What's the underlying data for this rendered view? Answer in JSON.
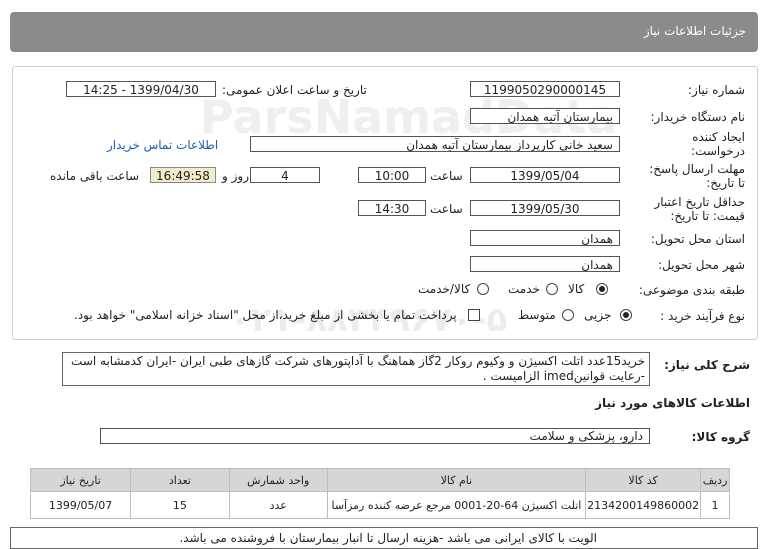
{
  "header": {
    "title": "جزئیات اطلاعات نیاز"
  },
  "form": {
    "need_number_label": "شماره نیاز:",
    "need_number": "1199050290000145",
    "announce_label": "تاریخ و ساعت اعلان عمومی:",
    "announce_value": "1399/04/30 - 14:25",
    "buyer_label": "نام دستگاه خریدار:",
    "buyer_value": "بیمارستان آتیه همدان",
    "creator_label_1": "ایجاد کننده",
    "creator_label_2": "درخواست:",
    "creator_value": "سعید خانی کارپرداز بیمارستان آتیه همدان",
    "contact_link": "اطلاعات تماس خریدار",
    "deadline_label_1": "مهلت ارسال پاسخ:",
    "deadline_label_2": "تا تاریخ:",
    "deadline_date": "1399/05/04",
    "time_label": "ساعت",
    "deadline_time": "10:00",
    "days_value": "4",
    "days_label": "روز و",
    "remaining_time": "16:49:58",
    "remaining_label": "ساعت باقی مانده",
    "validity_label_1": "حداقل تاریخ اعتبار",
    "validity_label_2": "قیمت: تا تاریخ:",
    "validity_date": "1399/05/30",
    "validity_time": "14:30",
    "province_label": "استان محل تحویل:",
    "province_value": "همدان",
    "city_label": "شهر محل تحویل:",
    "city_value": "همدان",
    "category_label": "طبقه بندی موضوعی:",
    "category_options": [
      "کالا",
      "خدمت",
      "کالا/خدمت"
    ],
    "category_selected": "کالا",
    "process_label": "نوع فرآیند خرید :",
    "process_options": [
      "جزیی",
      "متوسط"
    ],
    "process_selected": "جزیی",
    "payment_note": "پرداخت تمام یا بخشی از مبلغ خرید،از محل \"اسناد خزانه اسلامی\" خواهد بود."
  },
  "description": {
    "label": "شرح کلی نیاز:",
    "text": "خرید15عدد اتلت اکسیژن و وکیوم روکار 2گاز هماهنگ با آداپتورهای شرکت گازهای طبی ایران -ایران کدمشابه است -رعایت قوانینimed الزامیست ."
  },
  "goods": {
    "section_title": "اطلاعات کالاهای مورد نیاز",
    "group_label": "گروه کالا:",
    "group_value": "دارو، پزشکی و سلامت",
    "columns": [
      "ردیف",
      "کد کالا",
      "نام کالا",
      "واحد شمارش",
      "تعداد",
      "تاریخ نیاز"
    ],
    "rows": [
      {
        "index": "1",
        "code": "2134200149860002",
        "name": "اتلت اکسیژن 64-20-0001 مرجع عرضه کننده رمزآسا",
        "unit": "عدد",
        "qty": "15",
        "date": "1399/05/07"
      }
    ]
  },
  "note": "الویت با کالای ایرانی می باشد -هزینه ارسال تا انبار بیمارستان با فروشنده می باشد.",
  "watermark": {
    "line1": "ParsNamadData",
    "line2": "۰۲۱-۸۸۳۴۹۶۷۰-۵"
  }
}
